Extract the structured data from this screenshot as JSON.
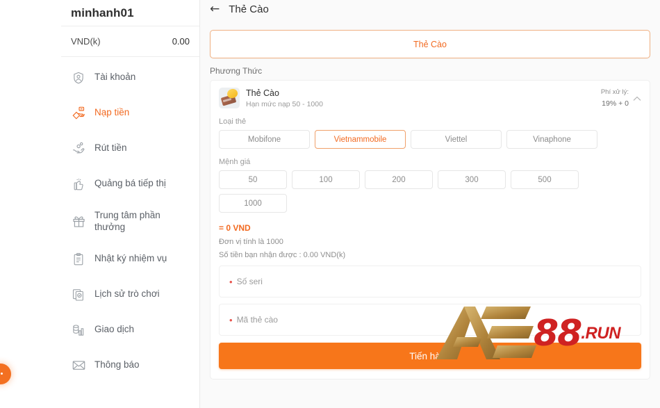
{
  "sidebar": {
    "username": "minhanh01",
    "balance_label": "VND(k)",
    "balance_value": "0.00",
    "items": [
      {
        "label": "Tài khoản",
        "icon": "user-shield-icon",
        "active": false
      },
      {
        "label": "Nạp tiền",
        "icon": "deposit-hand-icon",
        "active": true
      },
      {
        "label": "Rút tiền",
        "icon": "withdraw-hand-icon",
        "active": false
      },
      {
        "label": "Quảng bá tiếp thị",
        "icon": "thumbs-up-icon",
        "active": false
      },
      {
        "label": "Trung tâm phần thưởng",
        "icon": "gift-icon",
        "active": false
      },
      {
        "label": "Nhật ký nhiệm vụ",
        "icon": "clipboard-icon",
        "active": false
      },
      {
        "label": "Lịch sử trò chơi",
        "icon": "history-doc-icon",
        "active": false
      },
      {
        "label": "Giao dịch",
        "icon": "coins-chart-icon",
        "active": false
      },
      {
        "label": "Thông báo",
        "icon": "envelope-icon",
        "active": false
      }
    ]
  },
  "header": {
    "back_icon": "arrow-left-icon",
    "title": "Thẻ Cào"
  },
  "main": {
    "method_tab_label": "Thẻ Cào",
    "section_label": "Phương Thức",
    "card": {
      "icon": "scratch-card-icon",
      "name": "Thẻ Cào",
      "limit_text": "Hạn mức nạp 50 - 1000",
      "fee_label": "Phí xử lý:",
      "fee_value": "19% + 0",
      "collapse_icon": "chevron-up-icon",
      "carrier_group_label": "Loại thẻ",
      "carriers": [
        {
          "label": "Mobifone",
          "selected": false
        },
        {
          "label": "Vietnammobile",
          "selected": true
        },
        {
          "label": "Viettel",
          "selected": false
        },
        {
          "label": "Vinaphone",
          "selected": false
        }
      ],
      "amount_group_label": "Mệnh giá",
      "amounts": [
        {
          "label": "50",
          "selected": false
        },
        {
          "label": "100",
          "selected": false
        },
        {
          "label": "200",
          "selected": false
        },
        {
          "label": "300",
          "selected": false
        },
        {
          "label": "500",
          "selected": false
        },
        {
          "label": "1000",
          "selected": false
        }
      ],
      "total_text": "= 0 VND",
      "unit_note": "Đơn vị tính là 1000",
      "receive_note": "Số tiền bạn nhận được : 0.00 VND(k)",
      "serial_placeholder": "Số seri",
      "serial_value": "",
      "code_placeholder": "Mã thẻ cào",
      "code_value": "",
      "submit_label": "Tiến hành"
    }
  },
  "watermark": {
    "logo_text": "AE",
    "number_text": "88",
    "suffix_text": ".RUN",
    "gold_color": "#b8893f",
    "red_color": "#cf2222"
  },
  "colors": {
    "accent": "#f26a21",
    "submit": "#f7761a",
    "page_bg": "#fafafa",
    "sidebar_bg": "#ffffff"
  }
}
